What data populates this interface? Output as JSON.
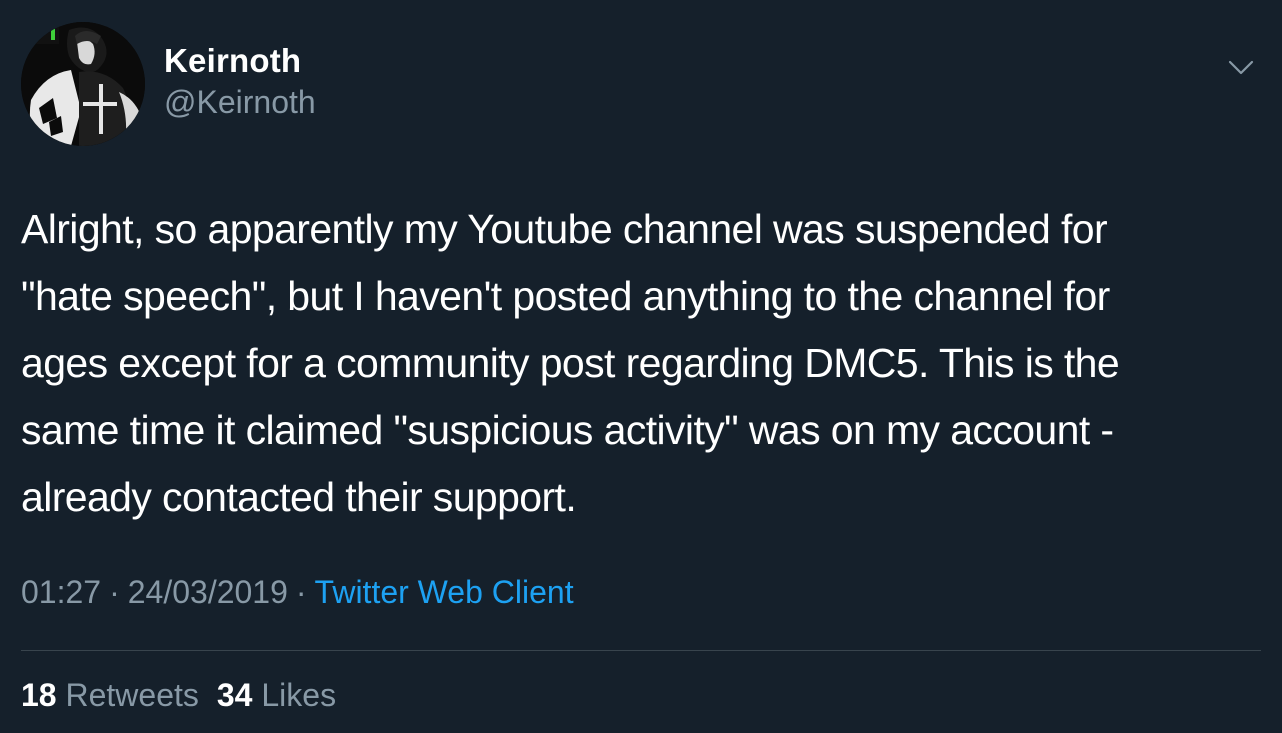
{
  "author": {
    "display_name": "Keirnoth",
    "handle": "@Keirnoth"
  },
  "tweet": {
    "text": "Alright, so apparently my Youtube channel was suspended for\n\"hate speech\", but I haven't posted anything to the channel for\nages except for a community post regarding DMC5. This is the\nsame time it claimed \"suspicious activity\" was on my account -\nalready contacted their support.",
    "time": "01:27",
    "date": "24/03/2019",
    "separator": "·",
    "client": "Twitter Web Client"
  },
  "stats": {
    "retweets_count": "18",
    "retweets_label": "Retweets",
    "likes_count": "34",
    "likes_label": "Likes"
  },
  "icons": {
    "menu": "chevron-down-icon"
  },
  "colors": {
    "background": "#15202b",
    "primary_text": "#ffffff",
    "secondary_text": "#8899a6",
    "link": "#1da1f2",
    "divider": "#38444d"
  }
}
